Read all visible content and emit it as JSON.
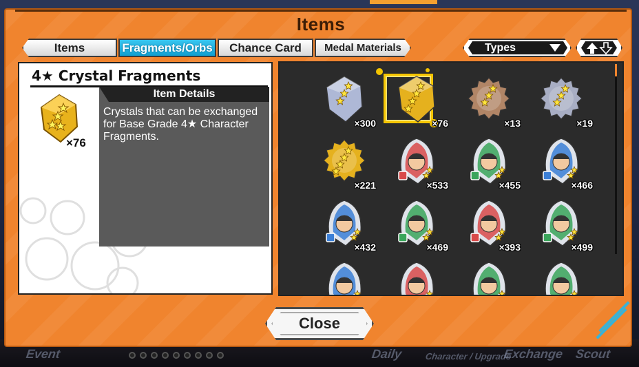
{
  "window": {
    "title": "Items"
  },
  "tabs": [
    {
      "label": "Items",
      "active": false
    },
    {
      "label": "Fragments/Orbs",
      "active": true
    },
    {
      "label": "Chance Card",
      "active": false
    },
    {
      "label": "Medal Materials",
      "active": false
    }
  ],
  "filter": {
    "types_label": "Types"
  },
  "selected": {
    "name": "4★ Crystal Fragments",
    "count": "×76",
    "details_header": "Item Details",
    "description": "Crystals that can be exchanged for Base Grade 4★ Character Fragments."
  },
  "grid": [
    {
      "count": "×300",
      "kind": "crystal",
      "color": "#aeb8d6",
      "stars": 3
    },
    {
      "count": "×76",
      "kind": "crystal",
      "color": "#e5b11e",
      "stars": 4,
      "selected": true
    },
    {
      "count": "×13",
      "kind": "spiky",
      "color": "#b18566",
      "stars": 3
    },
    {
      "count": "×19",
      "kind": "spiky",
      "color": "#a8aec4",
      "stars": 3
    },
    {
      "count": "×221",
      "kind": "spiky",
      "color": "#e5b11e",
      "stars": 4
    },
    {
      "count": "×533",
      "kind": "char",
      "color": "#d94a4a",
      "stars": 2
    },
    {
      "count": "×455",
      "kind": "char",
      "color": "#3aa55b",
      "stars": 2
    },
    {
      "count": "×466",
      "kind": "char",
      "color": "#3b7fd6",
      "stars": 2
    },
    {
      "count": "×432",
      "kind": "char",
      "color": "#3b7fd6",
      "stars": 2
    },
    {
      "count": "×469",
      "kind": "char",
      "color": "#3aa55b",
      "stars": 2
    },
    {
      "count": "×393",
      "kind": "char",
      "color": "#d94a4a",
      "stars": 2
    },
    {
      "count": "×499",
      "kind": "char",
      "color": "#3aa55b",
      "stars": 2
    },
    {
      "count": "",
      "kind": "char",
      "color": "#3b7fd6",
      "stars": 2
    },
    {
      "count": "",
      "kind": "char",
      "color": "#d94a4a",
      "stars": 2
    },
    {
      "count": "",
      "kind": "char",
      "color": "#3aa55b",
      "stars": 2
    },
    {
      "count": "",
      "kind": "char",
      "color": "#3aa55b",
      "stars": 2
    }
  ],
  "buttons": {
    "close_label": "Close"
  },
  "background_nav": {
    "event": "Event",
    "daily": "Daily",
    "character_upgrade": "Character / Upgrade",
    "exchange": "Exchange",
    "scout": "Scout"
  },
  "colors": {
    "frame": "#f0842e",
    "active_tab": "#1fb0e0",
    "selection": "#f4c400"
  }
}
